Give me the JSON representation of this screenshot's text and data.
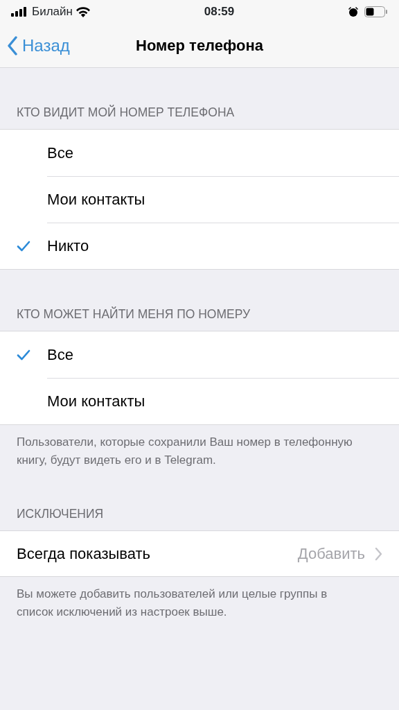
{
  "status_bar": {
    "carrier": "Билайн",
    "time": "08:59"
  },
  "nav": {
    "back": "Назад",
    "title": "Номер телефона"
  },
  "sections": [
    {
      "kind": "radio",
      "header": "КТО ВИДИТ МОЙ НОМЕР ТЕЛЕФОНА",
      "options": [
        {
          "label": "Все",
          "selected": false
        },
        {
          "label": "Мои контакты",
          "selected": false
        },
        {
          "label": "Никто",
          "selected": true
        }
      ]
    },
    {
      "kind": "radio",
      "header": "КТО МОЖЕТ НАЙТИ МЕНЯ ПО НОМЕРУ",
      "options": [
        {
          "label": "Все",
          "selected": true
        },
        {
          "label": "Мои контакты",
          "selected": false
        }
      ],
      "footer": "Пользователи, которые сохранили Ваш номер в телефонную книгу, будут видеть его и в Telegram."
    },
    {
      "kind": "link",
      "header": "ИСКЛЮЧЕНИЯ",
      "items": [
        {
          "label": "Всегда показывать",
          "value": "Добавить"
        }
      ],
      "footer": "Вы можете добавить пользователей или целые группы в список исключений из настроек выше."
    }
  ]
}
